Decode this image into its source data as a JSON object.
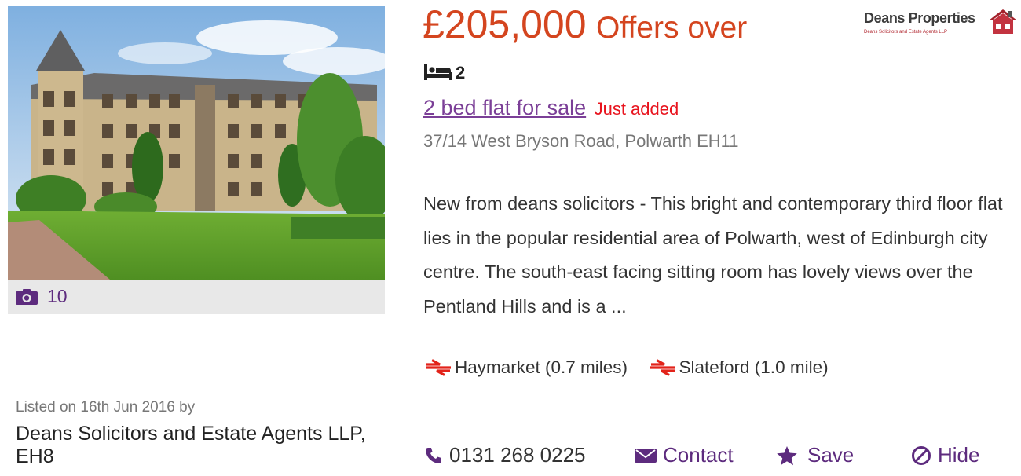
{
  "photo": {
    "alt_icon": "property-photo",
    "count_icon": "camera-icon",
    "count": "10"
  },
  "listing_meta": {
    "listed_on": "Listed on 16th Jun 2016 by",
    "agent": "Deans Solicitors and Estate Agents LLP, EH8"
  },
  "price": {
    "amount": "£205,000",
    "qualifier": "Offers over",
    "color": "#d4451f"
  },
  "brand": {
    "name": "Deans Properties",
    "sub": "Deans Solicitors and Estate Agents LLP",
    "icon": "house-logo-icon"
  },
  "bedrooms": {
    "icon": "bed-icon",
    "count": "2"
  },
  "listing": {
    "title": "2 bed flat for sale",
    "badge": "Just added",
    "address": "37/14 West Bryson Road, Polwarth EH11",
    "description": "New from deans solicitors - This bright and contemporary third floor flat lies in the popular residential area of Polwarth, west of Edinburgh city centre. The south-east facing sitting room has lovely views over the Pentland Hills and is a ...",
    "title_color": "#7b3f97",
    "badge_color": "#e8141e"
  },
  "stations": [
    {
      "icon": "national-rail-icon",
      "label": "Haymarket (0.7 miles)"
    },
    {
      "icon": "national-rail-icon",
      "label": "Slateford (1.0 mile)"
    }
  ],
  "actions": {
    "phone": {
      "icon": "phone-icon",
      "label": "0131 268 0225"
    },
    "contact": {
      "icon": "envelope-icon",
      "label": "Contact"
    },
    "save": {
      "icon": "star-icon",
      "label": "Save"
    },
    "hide": {
      "icon": "hide-icon",
      "label": "Hide"
    },
    "accent_color": "#5d2b7e"
  }
}
